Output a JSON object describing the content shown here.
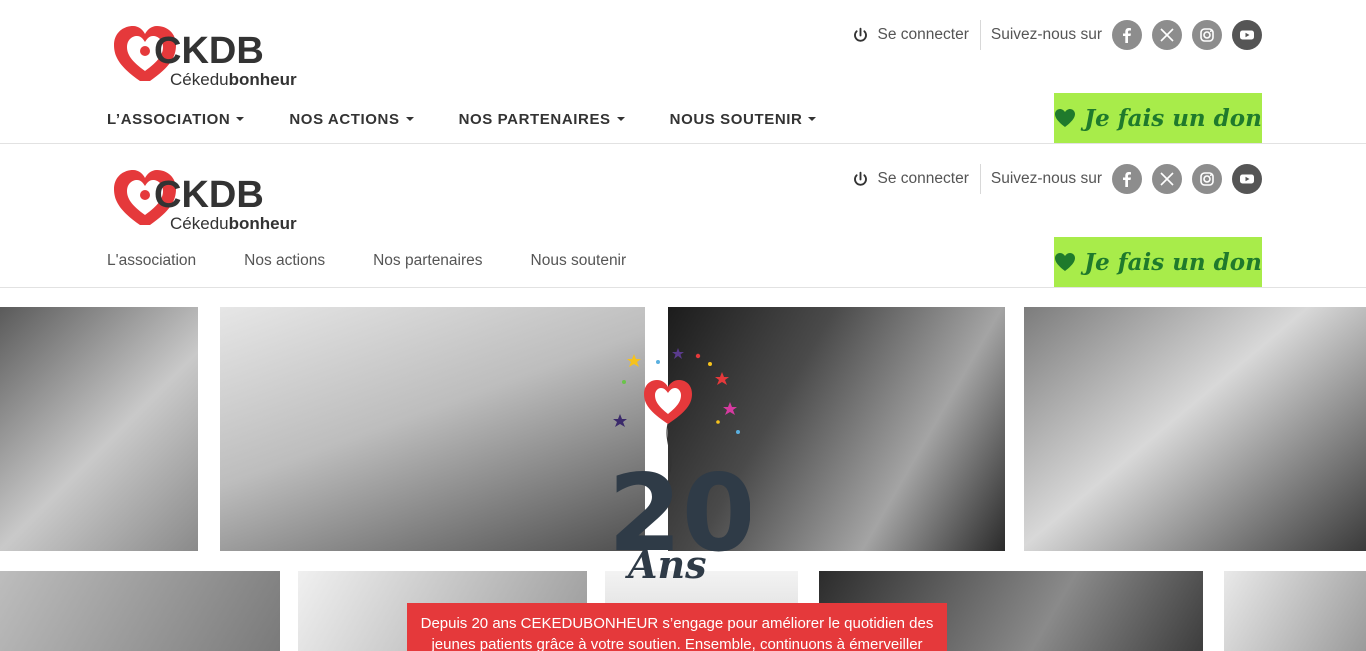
{
  "brand": {
    "name": "CKDB",
    "tagline_prefix": "Céke",
    "tagline_du": "du",
    "tagline_suffix": "bonheur",
    "heart_color": "#e5393b",
    "text_color": "#333333"
  },
  "topbar": {
    "login_label": "Se connecter",
    "login_icon": "power-icon",
    "follow_label": "Suivez-nous sur",
    "social": [
      "facebook-icon",
      "x-icon",
      "instagram-icon",
      "youtube-icon"
    ]
  },
  "nav_primary": {
    "items": [
      {
        "label": "L’ASSOCIATION"
      },
      {
        "label": "NOS ACTIONS"
      },
      {
        "label": "NOS PARTENAIRES"
      },
      {
        "label": "NOUS SOUTENIR"
      }
    ]
  },
  "nav_secondary": {
    "items": [
      {
        "label": "L'association"
      },
      {
        "label": "Nos actions"
      },
      {
        "label": "Nos partenaires"
      },
      {
        "label": "Nous soutenir"
      }
    ]
  },
  "donate": {
    "label": "Je fais un don",
    "icon": "heart-icon",
    "bg": "#a8ec4a",
    "fg": "#1f7a2c"
  },
  "anniversary": {
    "number": "20",
    "word": "Ans"
  },
  "banner": {
    "text": "Depuis 20 ans CEKEDUBONHEUR s’engage pour améliorer le quotidien des jeunes patients grâce à votre soutien. Ensemble, continuons à émerveiller",
    "bg": "#e5393b"
  }
}
